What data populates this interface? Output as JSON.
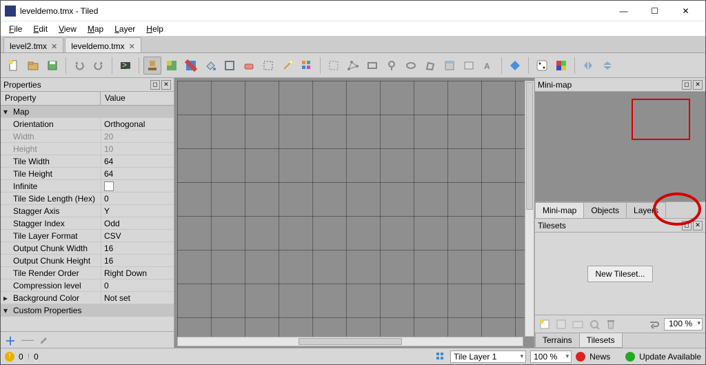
{
  "titlebar": {
    "title": "leveldemo.tmx - Tiled"
  },
  "menu": {
    "items": [
      "File",
      "Edit",
      "View",
      "Map",
      "Layer",
      "Help"
    ]
  },
  "tabs": [
    {
      "label": "level2.tmx",
      "active": false
    },
    {
      "label": "leveldemo.tmx",
      "active": true
    }
  ],
  "panels": {
    "properties": {
      "title": "Properties",
      "columns": [
        "Property",
        "Value"
      ],
      "groups": [
        {
          "name": "Map",
          "rows": [
            {
              "k": "Orientation",
              "v": "Orthogonal"
            },
            {
              "k": "Width",
              "v": "20",
              "disabled": true
            },
            {
              "k": "Height",
              "v": "10",
              "disabled": true
            },
            {
              "k": "Tile Width",
              "v": "64"
            },
            {
              "k": "Tile Height",
              "v": "64"
            },
            {
              "k": "Infinite",
              "v": "",
              "checkbox": true
            },
            {
              "k": "Tile Side Length (Hex)",
              "v": "0"
            },
            {
              "k": "Stagger Axis",
              "v": "Y"
            },
            {
              "k": "Stagger Index",
              "v": "Odd"
            },
            {
              "k": "Tile Layer Format",
              "v": "CSV"
            },
            {
              "k": "Output Chunk Width",
              "v": "16"
            },
            {
              "k": "Output Chunk Height",
              "v": "16"
            },
            {
              "k": "Tile Render Order",
              "v": "Right Down"
            },
            {
              "k": "Compression level",
              "v": "0"
            },
            {
              "k": "Background Color",
              "v": "Not set",
              "collapsed": true
            }
          ]
        },
        {
          "name": "Custom Properties",
          "rows": []
        }
      ]
    },
    "minimap": {
      "title": "Mini-map",
      "tabs": [
        "Mini-map",
        "Objects",
        "Layers"
      ],
      "active": 0
    },
    "tilesets": {
      "title": "Tilesets",
      "button": "New Tileset...",
      "zoom": "100 %",
      "tabs": [
        "Terrains",
        "Tilesets"
      ],
      "active": 1
    }
  },
  "status": {
    "errors": "0",
    "warnings": "0",
    "layer_label": "Tile Layer 1",
    "zoom": "100 %",
    "news": "News",
    "update": "Update Available"
  }
}
